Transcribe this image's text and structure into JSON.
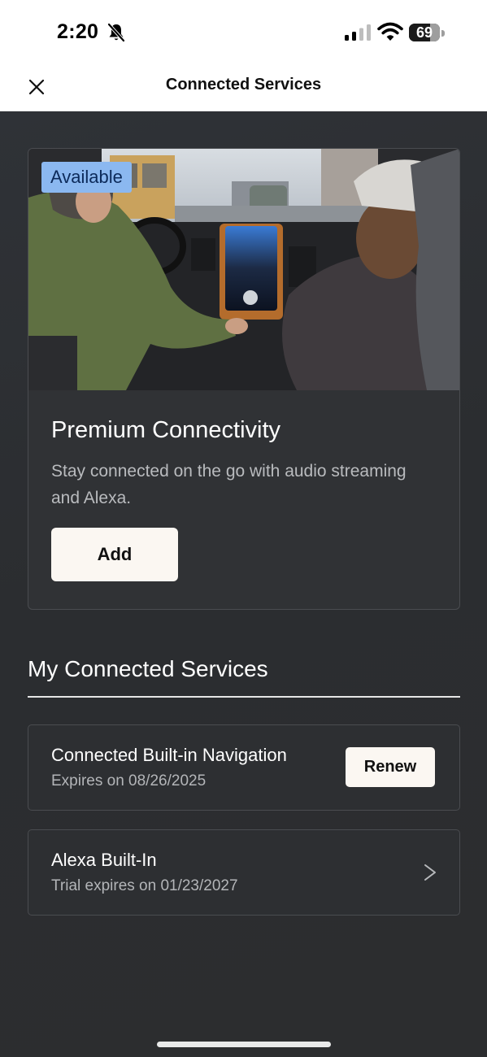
{
  "status_bar": {
    "time": "2:20",
    "battery_level": "69",
    "battery_fraction": 0.69
  },
  "header": {
    "title": "Connected Services",
    "close_icon": "close-icon"
  },
  "promo": {
    "badge": "Available",
    "image_icon": "vehicle-interior-photo",
    "title": "Premium Connectivity",
    "description": "Stay connected on the go with audio streaming and Alexa.",
    "button_label": "Add"
  },
  "my_services": {
    "title": "My Connected Services",
    "items": [
      {
        "name": "Connected Built-in Navigation",
        "subtitle": "Expires on 08/26/2025",
        "action_label": "Renew"
      },
      {
        "name": "Alexa Built-In",
        "subtitle": "Trial expires on 01/23/2027",
        "action_icon": "chevron-right-icon"
      }
    ]
  },
  "colors": {
    "background": "#2b2d30",
    "badge_bg": "#8bb8f0",
    "button_bg": "#fbf7f2"
  }
}
